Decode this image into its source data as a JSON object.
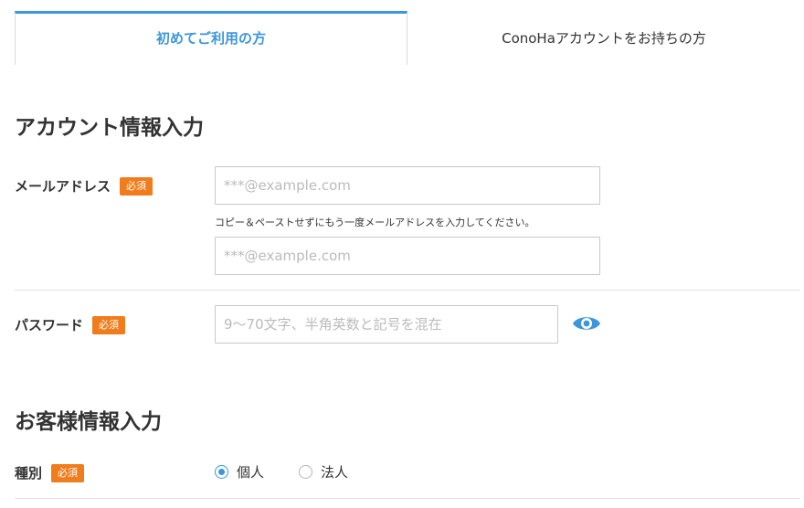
{
  "tabs": [
    {
      "label": "初めてご利用の方",
      "active": true
    },
    {
      "label": "ConoHaアカウントをお持ちの方",
      "active": false
    }
  ],
  "account_section": {
    "title": "アカウント情報入力",
    "email": {
      "label": "メールアドレス",
      "badge": "必須",
      "placeholder": "***@example.com",
      "hint": "コピー＆ペーストせずにもう一度メールアドレスを入力してください。",
      "confirm_placeholder": "***@example.com"
    },
    "password": {
      "label": "パスワード",
      "badge": "必須",
      "placeholder": "9〜70文字、半角英数と記号を混在"
    }
  },
  "customer_section": {
    "title": "お客様情報入力",
    "type": {
      "label": "種別",
      "badge": "必須",
      "options": [
        {
          "label": "個人",
          "checked": true
        },
        {
          "label": "法人",
          "checked": false
        }
      ]
    }
  },
  "colors": {
    "accent": "#3c96dc",
    "badge": "#f07c1c"
  }
}
